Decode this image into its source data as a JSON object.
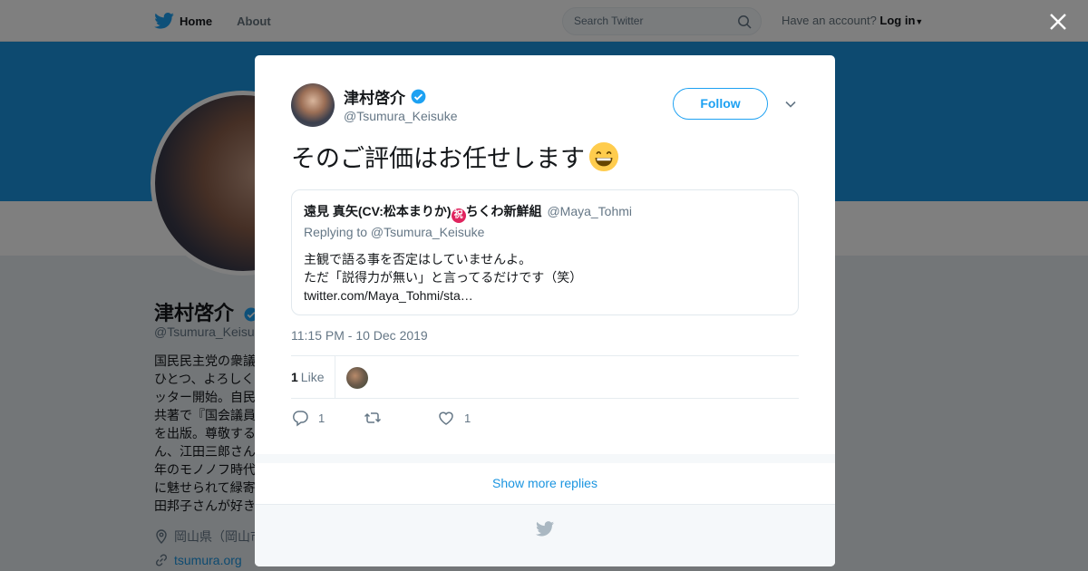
{
  "nav": {
    "home": "Home",
    "about": "About",
    "search_placeholder": "Search Twitter",
    "have_account": "Have an account?",
    "login": "Log in"
  },
  "profile": {
    "name": "津村啓介",
    "handle": "@Tsumura_Keisu",
    "bio_lines": [
      "国民民主党の衆議",
      "ひとつ、よろしく",
      "ッター開始。自民",
      "共著で『国会議員",
      "を出版。尊敬する",
      "ん、江田三郎さん",
      "年のモノノフ時代",
      "に魅せられて緑寄",
      "田邦子さんが好き"
    ],
    "location": "岡山県（岡山市",
    "url": "tsumura.org"
  },
  "tweet": {
    "author_name": "津村啓介",
    "author_handle": "@Tsumura_Keisuke",
    "follow_label": "Follow",
    "text": "そのご評価はお任せします",
    "emoji": "grinning-face-emoji",
    "quote": {
      "name": "遠見 真矢(CV:松本まりか)",
      "badge": "祝",
      "name_suffix": "ちくわ新鮮組",
      "handle": "@Maya_Tohmi",
      "replying_to": "Replying to @Tsumura_Keisuke",
      "body_lines": [
        "主観で語る事を否定はしていませんよ。",
        "ただ「説得力が無い」と言ってるだけです（笑）",
        "twitter.com/Maya_Tohmi/sta…"
      ]
    },
    "timestamp": "11:15 PM - 10 Dec 2019",
    "likes_count": "1",
    "likes_label": "Like",
    "reply_count": "1",
    "retweet_count": "",
    "like_action_count": "1"
  },
  "show_more": "Show more replies",
  "colors": {
    "accent": "#1da1f2",
    "banner": "#1b95e0",
    "link": "#1b95e0"
  }
}
